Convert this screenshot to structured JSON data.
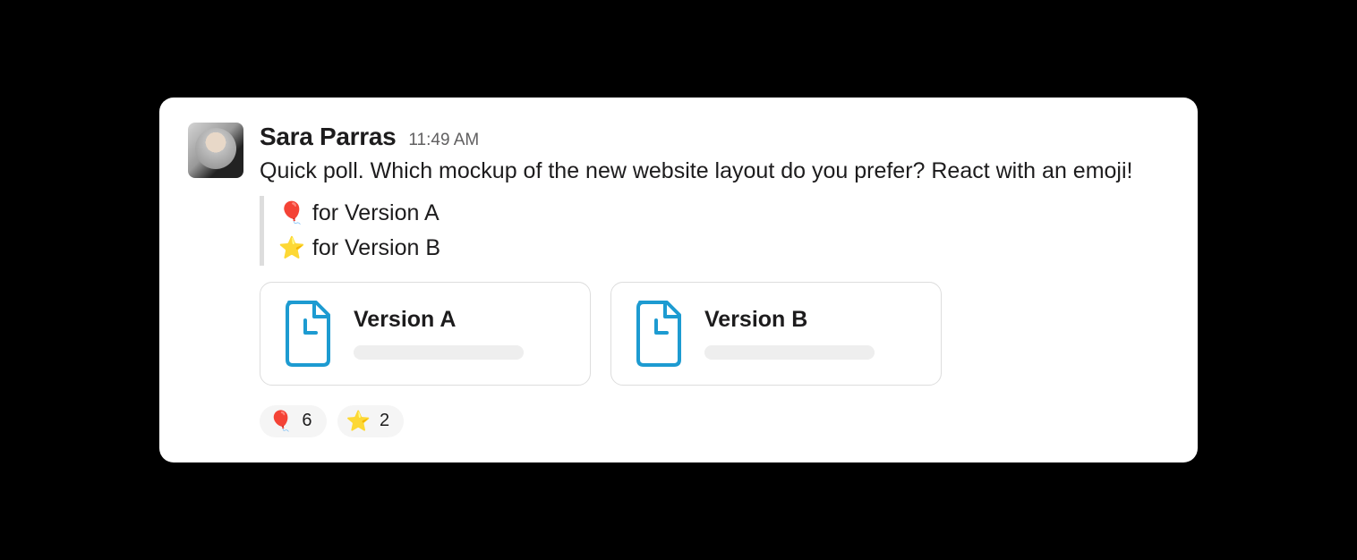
{
  "message": {
    "author": "Sara Parras",
    "timestamp": "11:49 AM",
    "text": "Quick poll. Which mockup of the new website layout do you prefer? React with an emoji!",
    "poll_options": [
      {
        "emoji": "🎈",
        "label": "for Version A"
      },
      {
        "emoji": "⭐",
        "label": "for Version B"
      }
    ],
    "attachments": [
      {
        "title": "Version A"
      },
      {
        "title": "Version B"
      }
    ],
    "reactions": [
      {
        "emoji": "🎈",
        "count": "6"
      },
      {
        "emoji": "⭐",
        "count": "2"
      }
    ]
  }
}
